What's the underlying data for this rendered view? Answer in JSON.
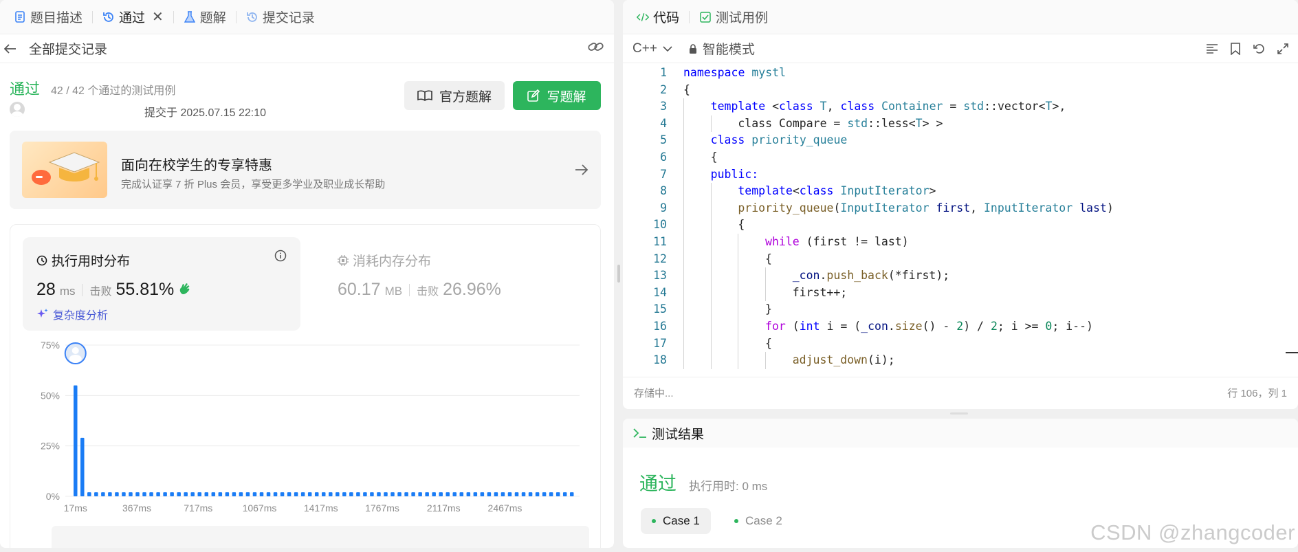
{
  "left_tabs": [
    {
      "label": "题目描述",
      "icon": "document-icon"
    },
    {
      "label": "通过",
      "icon": "history-icon"
    },
    {
      "label": "题解",
      "icon": "flask-icon"
    },
    {
      "label": "提交记录",
      "icon": "history-icon"
    }
  ],
  "subbar": {
    "title": "全部提交记录"
  },
  "submission": {
    "status": "通过",
    "cases": "42 / 42 个通过的测试用例",
    "submitted_at": "提交于 2025.07.15 22:10"
  },
  "buttons": {
    "official": "官方题解",
    "write": "写题解"
  },
  "promo": {
    "title": "面向在校学生的专享特惠",
    "subtitle": "完成认证享 7 折 Plus 会员，享受更多学业及职业成长帮助"
  },
  "runtime": {
    "title": "执行用时分布",
    "value": "28",
    "unit": "ms",
    "beat_label": "击败",
    "beat": "55.81%",
    "complexity": "复杂度分析"
  },
  "memory": {
    "title": "消耗内存分布",
    "value": "60.17",
    "unit": "MB",
    "beat_label": "击败",
    "beat": "26.96%"
  },
  "chart_data": {
    "type": "bar",
    "yticks": [
      "75%",
      "50%",
      "25%",
      "0%"
    ],
    "ylim": [
      0,
      75
    ],
    "xticks": [
      "17ms",
      "367ms",
      "717ms",
      "1067ms",
      "1417ms",
      "1767ms",
      "2117ms",
      "2467ms"
    ],
    "values": [
      55,
      29,
      2,
      2,
      2,
      2,
      2,
      2,
      2,
      2,
      2,
      2,
      2,
      2,
      2,
      2,
      2,
      2,
      2,
      2,
      2,
      2,
      2,
      2,
      2,
      2,
      2,
      2,
      2,
      2,
      2,
      2,
      2,
      2,
      2,
      2,
      2,
      2,
      2,
      2,
      2,
      2,
      2,
      2,
      2,
      2,
      2,
      2,
      2,
      2,
      2,
      2,
      2,
      2,
      2,
      2,
      2,
      2,
      2,
      2,
      2,
      2,
      2,
      2,
      2,
      2,
      2,
      2,
      2,
      2,
      2,
      2,
      2
    ],
    "bar_color": "#1a7cf5",
    "grid": true
  },
  "editor": {
    "tabs": [
      {
        "label": "代码",
        "icon": "code-icon"
      },
      {
        "label": "测试用例",
        "icon": "checkbox-icon"
      }
    ],
    "language": "C++",
    "mode": "智能模式",
    "status_left": "存储中...",
    "status_right": "行 106，列 1",
    "lines": [
      {
        "n": "1",
        "indent": 0,
        "html": "<span class='k'>namespace</span> <span class='t'>mystl</span>"
      },
      {
        "n": "2",
        "indent": 0,
        "html": "<span class='p'>{</span>"
      },
      {
        "n": "3",
        "indent": 1,
        "html": "<span class='k'>template</span> &lt;<span class='k'>class</span> <span class='t'>T</span>, <span class='k'>class</span> <span class='t'>Container</span> = <span class='t'>std</span>::vector&lt;<span class='t'>T</span>&gt;,"
      },
      {
        "n": "4",
        "indent": 2,
        "html": "class Compare = <span class='t'>std</span>::less&lt;<span class='t'>T</span>&gt; &gt;"
      },
      {
        "n": "5",
        "indent": 1,
        "html": "<span class='k'>class</span> <span class='t'>priority_queue</span>"
      },
      {
        "n": "6",
        "indent": 1,
        "html": "{"
      },
      {
        "n": "7",
        "indent": 1,
        "html": "<span class='k'>public:</span>"
      },
      {
        "n": "8",
        "indent": 2,
        "html": "<span class='k'>template</span>&lt;<span class='k'>class</span> <span class='t'>InputIterator</span>&gt;"
      },
      {
        "n": "9",
        "indent": 2,
        "html": "<span class='f'>priority_queue</span>(<span class='t'>InputIterator</span> <span class='v'>first</span>, <span class='t'>InputIterator</span> <span class='v'>last</span>)"
      },
      {
        "n": "10",
        "indent": 2,
        "html": "{"
      },
      {
        "n": "11",
        "indent": 3,
        "html": "<span class='k2'>while</span> (first != last)"
      },
      {
        "n": "12",
        "indent": 3,
        "html": "{"
      },
      {
        "n": "13",
        "indent": 4,
        "html": "<span class='v'>_con</span>.<span class='f'>push_back</span>(*first);"
      },
      {
        "n": "14",
        "indent": 4,
        "html": "first++;"
      },
      {
        "n": "15",
        "indent": 3,
        "html": "}"
      },
      {
        "n": "16",
        "indent": 3,
        "html": "<span class='k2'>for</span> (<span class='k'>int</span> i = (<span class='v'>_con</span>.<span class='f'>size</span>() - <span class='n'>2</span>) / <span class='n'>2</span>; i &gt;= <span class='n'>0</span>; i--)"
      },
      {
        "n": "17",
        "indent": 3,
        "html": "{"
      },
      {
        "n": "18",
        "indent": 4,
        "html": "<span class='f'>adjust_down</span>(i);"
      }
    ]
  },
  "result": {
    "title": "测试结果",
    "status": "通过",
    "runtime": "执行用时: 0 ms",
    "cases": [
      "Case 1",
      "Case 2"
    ]
  },
  "watermark": "CSDN @zhangcoder"
}
